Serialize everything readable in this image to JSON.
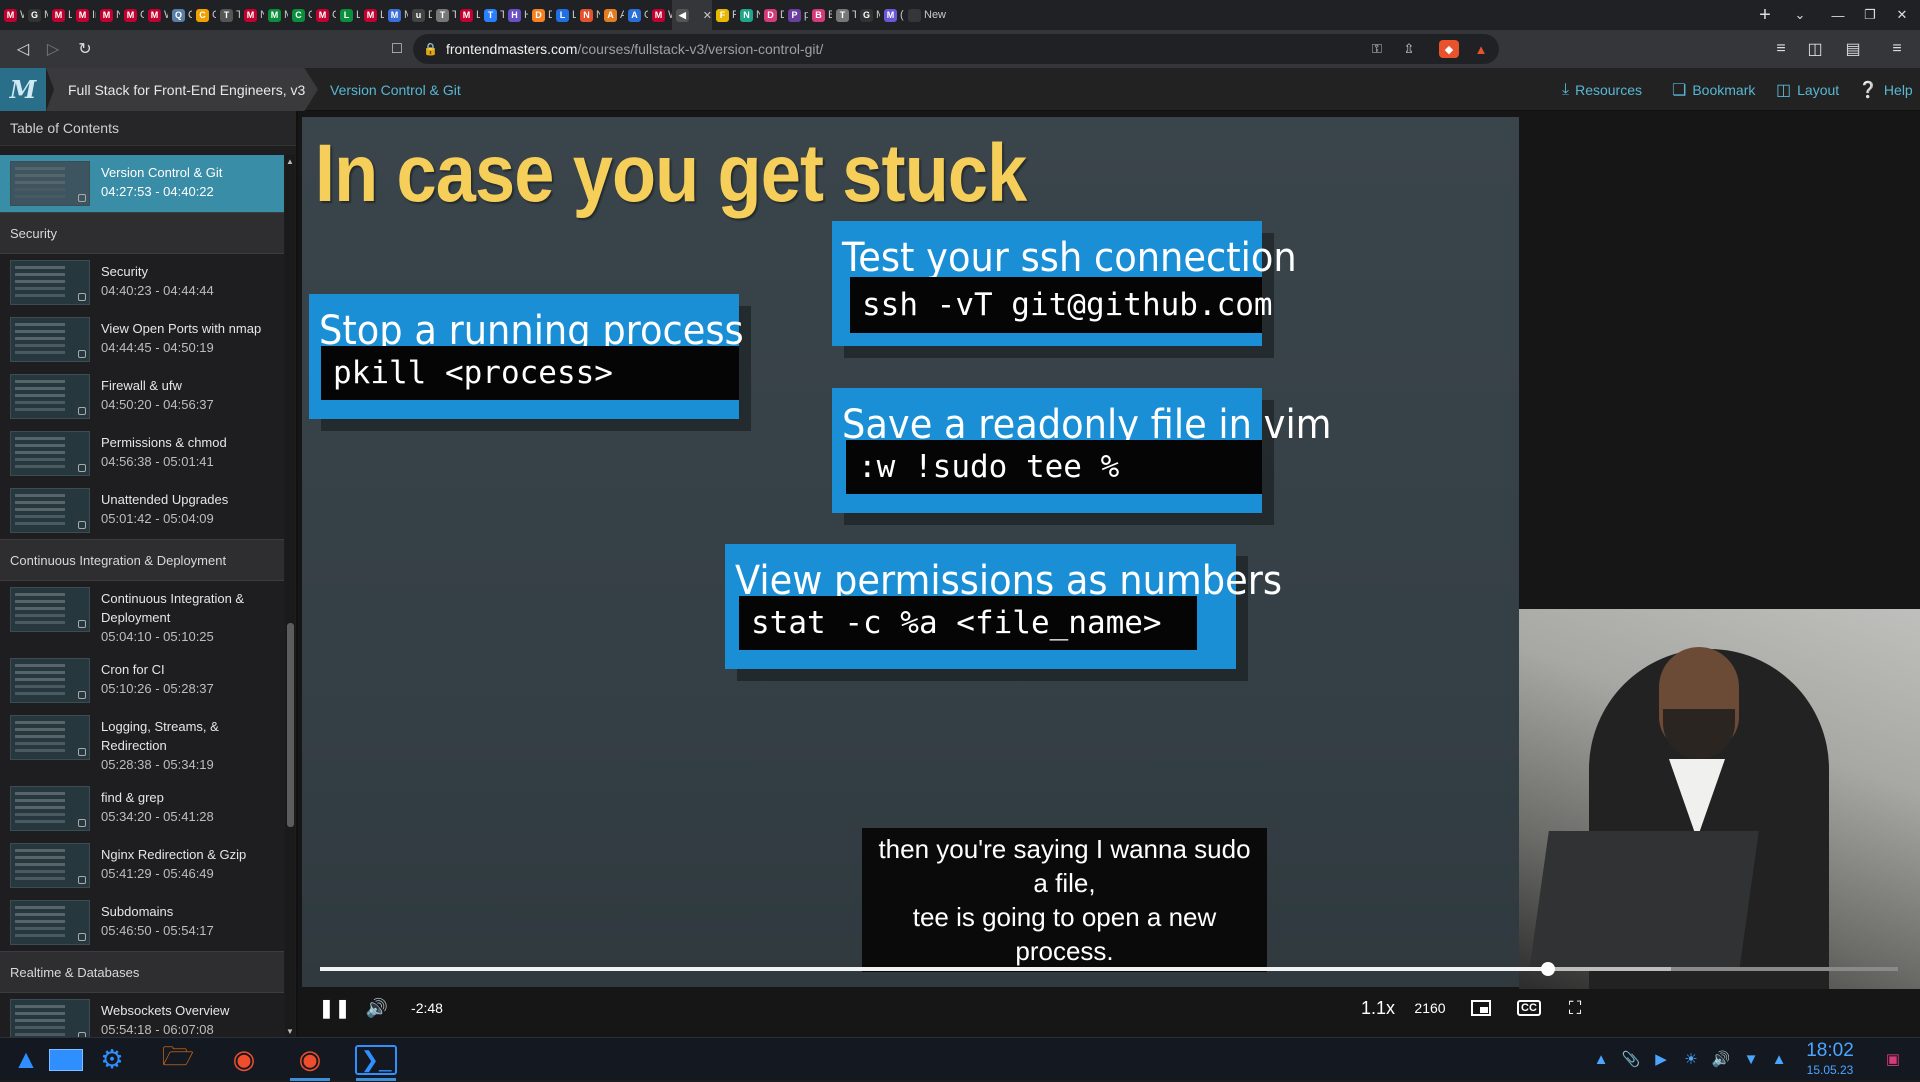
{
  "browser": {
    "tabs": [
      {
        "label": "W",
        "color": "#c3002f",
        "icon": "M"
      },
      {
        "label": "M",
        "color": "#333333",
        "icon": "G"
      },
      {
        "label": "Li",
        "color": "#c3002f",
        "icon": "M"
      },
      {
        "label": "In",
        "color": "#c3002f",
        "icon": "M"
      },
      {
        "label": "N",
        "color": "#c3002f",
        "icon": "M"
      },
      {
        "label": "Gr",
        "color": "#c3002f",
        "icon": "M"
      },
      {
        "label": "W",
        "color": "#c3002f",
        "icon": "M"
      },
      {
        "label": "Q",
        "color": "#5a7fa6",
        "icon": "Q"
      },
      {
        "label": "Cl",
        "color": "#f0a000",
        "icon": "C"
      },
      {
        "label": "Th",
        "color": "#555555",
        "icon": "T"
      },
      {
        "label": "N",
        "color": "#c3002f",
        "icon": "M"
      },
      {
        "label": "M",
        "color": "#0a8f3c",
        "icon": "M"
      },
      {
        "label": "Cl",
        "color": "#0a8f3c",
        "icon": "C"
      },
      {
        "label": "Cc",
        "color": "#c3002f",
        "icon": "M"
      },
      {
        "label": "Le",
        "color": "#0a8f3c",
        "icon": "L"
      },
      {
        "label": "Le",
        "color": "#c3002f",
        "icon": "M"
      },
      {
        "label": "M",
        "color": "#3a6fd8",
        "icon": "M"
      },
      {
        "label": "Da",
        "color": "#444444",
        "icon": "u"
      },
      {
        "label": "To",
        "color": "#777777",
        "icon": "T"
      },
      {
        "label": "Le",
        "color": "#c3002f",
        "icon": "M"
      },
      {
        "label": "Th",
        "color": "#2a7fff",
        "icon": "T"
      },
      {
        "label": "H",
        "color": "#6a4fc8",
        "icon": "H"
      },
      {
        "label": "Dl",
        "color": "#f58220",
        "icon": "D"
      },
      {
        "label": "Lo",
        "color": "#1f6fe5",
        "icon": "L"
      },
      {
        "label": "N",
        "color": "#e4512b",
        "icon": "N"
      },
      {
        "label": "AV",
        "color": "#e57c1f",
        "icon": "A"
      },
      {
        "label": "O",
        "color": "#2a6fd8",
        "icon": "A"
      },
      {
        "label": "W",
        "color": "#c3002f",
        "icon": "M"
      },
      {
        "label": "",
        "color": "#555555",
        "icon": "◀",
        "active": true
      },
      {
        "label": "Fu",
        "color": "#e6b800",
        "icon": "F"
      },
      {
        "label": "Ni",
        "color": "#1fa68a",
        "icon": "N"
      },
      {
        "label": "Dr",
        "color": "#d63a7a",
        "icon": "D"
      },
      {
        "label": "pl",
        "color": "#6b3fa0",
        "icon": "P"
      },
      {
        "label": "Br",
        "color": "#d63a7a",
        "icon": "B"
      },
      {
        "label": "Tc",
        "color": "#777777",
        "icon": "T"
      },
      {
        "label": "M",
        "color": "#333333",
        "icon": "G"
      },
      {
        "label": "(2",
        "color": "#6b57d6",
        "icon": "M"
      },
      {
        "label": "New T",
        "color": "#35363a",
        "icon": ""
      }
    ],
    "new_tab": "+",
    "url_domain": "frontendmasters.com",
    "url_path": "/courses/fullstack-v3/version-control-git/"
  },
  "site": {
    "logo": "M",
    "course_title": "Full Stack for Front-End Engineers, v3",
    "lesson_title": "Version Control & Git",
    "resources": "Resources",
    "bookmark": "Bookmark",
    "layout": "Layout",
    "help": "Help"
  },
  "sidebar": {
    "title": "Table of Contents",
    "current": {
      "title": "Version Control & Git",
      "time": "04:27:53 - 04:40:22"
    },
    "sections": [
      {
        "name": "Security",
        "lessons": [
          {
            "title": "Security",
            "time": "04:40:23 - 04:44:44"
          },
          {
            "title": "View Open Ports with nmap",
            "time": "04:44:45 - 04:50:19"
          },
          {
            "title": "Firewall & ufw",
            "time": "04:50:20 - 04:56:37"
          },
          {
            "title": "Permissions & chmod",
            "time": "04:56:38 - 05:01:41"
          },
          {
            "title": "Unattended Upgrades",
            "time": "05:01:42 - 05:04:09"
          }
        ]
      },
      {
        "name": "Continuous Integration & Deployment",
        "lessons": [
          {
            "title": "Continuous Integration & Deployment",
            "time": "05:04:10 - 05:10:25"
          },
          {
            "title": "Cron for CI",
            "time": "05:10:26 - 05:28:37"
          },
          {
            "title": "Logging, Streams, & Redirection",
            "time": "05:28:38 - 05:34:19"
          },
          {
            "title": "find & grep",
            "time": "05:34:20 - 05:41:28"
          },
          {
            "title": "Nginx Redirection & Gzip",
            "time": "05:41:29 - 05:46:49"
          },
          {
            "title": "Subdomains",
            "time": "05:46:50 - 05:54:17"
          }
        ]
      },
      {
        "name": "Realtime & Databases",
        "lessons": [
          {
            "title": "Websockets Overview",
            "time": "05:54:18 - 06:07:08"
          }
        ]
      }
    ]
  },
  "slide": {
    "title": "In case you get stuck",
    "cards": {
      "ssh": {
        "title": "Test your ssh connection",
        "cmd": "ssh -vT git@github.com"
      },
      "pkill": {
        "title": "Stop a running process",
        "cmd": "pkill <process>"
      },
      "vim": {
        "title": "Save a readonly file in vim",
        "cmd": ":w !sudo tee %"
      },
      "stat": {
        "title": "View permissions as numbers",
        "cmd": "stat -c %a <file_name>"
      }
    },
    "colors": {
      "title": "#f6cf5a",
      "card": "#1a8fd6",
      "cmd_bg": "#050505"
    }
  },
  "captions": {
    "line1": "then you're saying I wanna sudo a file,",
    "line2": "tee is going to open a new process."
  },
  "player": {
    "progress": 0.778,
    "buffered": 0.856,
    "time_remaining": "-2:48",
    "speed": "1.1x",
    "quality": "2160"
  },
  "taskbar": {
    "time": "18:02",
    "date": "15.05.23"
  }
}
